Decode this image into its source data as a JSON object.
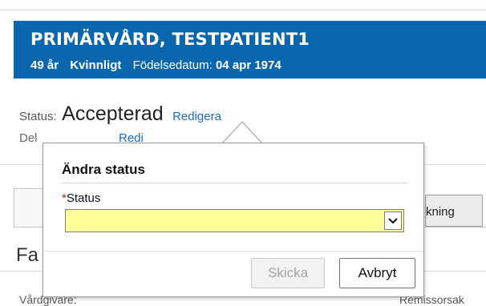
{
  "patient": {
    "name": "PRIMÄRVÅRD, TESTPATIENT1",
    "age": "49 år",
    "gender": "Kvinnligt",
    "dob_label": "Födelsedatum:",
    "dob_value": "04 apr 1974"
  },
  "status": {
    "label": "Status:",
    "value": "Accepterad",
    "edit_link": "Redigera"
  },
  "row2": {
    "label": "Del",
    "link": "Redi"
  },
  "background": {
    "tab_right_label": "kning",
    "heading": "Fa",
    "footer_left": "Vårdgivare:",
    "footer_right": "Remissorsak"
  },
  "dialog": {
    "title": "Ändra status",
    "field_required_marker": "*",
    "field_label": "Status",
    "select_value": "",
    "select_bg_color": "#ffff99",
    "send_button": "Skicka",
    "send_button_disabled": true,
    "cancel_button": "Avbryt"
  },
  "colors": {
    "banner": "#0a67ad",
    "link": "#1a6bc4",
    "required": "#dd1111"
  }
}
